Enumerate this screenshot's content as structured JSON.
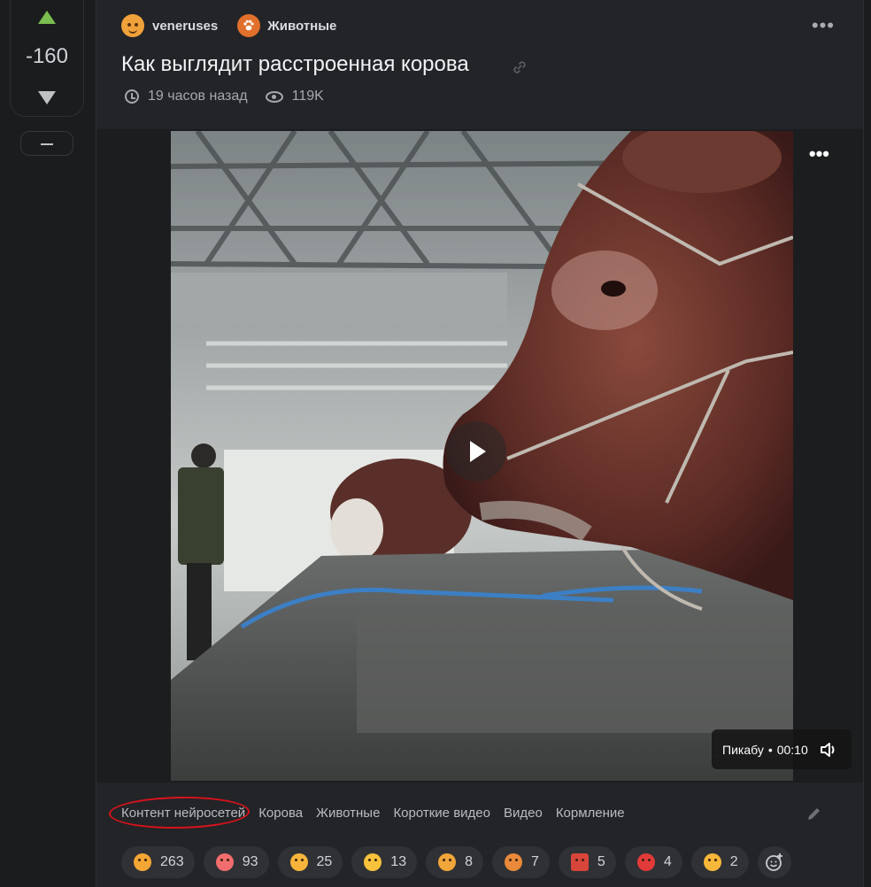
{
  "vote": {
    "count": "-160"
  },
  "post": {
    "author": "veneruses",
    "community": "Животные",
    "title": "Как выглядит расстроенная корова",
    "time": "19 часов назад",
    "views": "119K"
  },
  "video": {
    "source": "Пикабу",
    "separator": "•",
    "duration": "00:10"
  },
  "tags": [
    "Контент нейросетей",
    "Корова",
    "Животные",
    "Короткие видео",
    "Видео",
    "Кормление"
  ],
  "reactions": [
    {
      "count": "263",
      "color": "#f4a634"
    },
    {
      "count": "93",
      "color": "#f26d6d"
    },
    {
      "count": "25",
      "color": "#f7b43a"
    },
    {
      "count": "13",
      "color": "#f9c23c"
    },
    {
      "count": "8",
      "color": "#f0a63a"
    },
    {
      "count": "7",
      "color": "#e98a3a"
    },
    {
      "count": "5",
      "color": "#d8453a"
    },
    {
      "count": "4",
      "color": "#e23a3a"
    },
    {
      "count": "2",
      "color": "#f7b73a"
    }
  ],
  "colors": {
    "upvote": "#7bbd4e",
    "annotation": "#d8121c",
    "background": "#1b1c1e",
    "card": "#232427"
  }
}
